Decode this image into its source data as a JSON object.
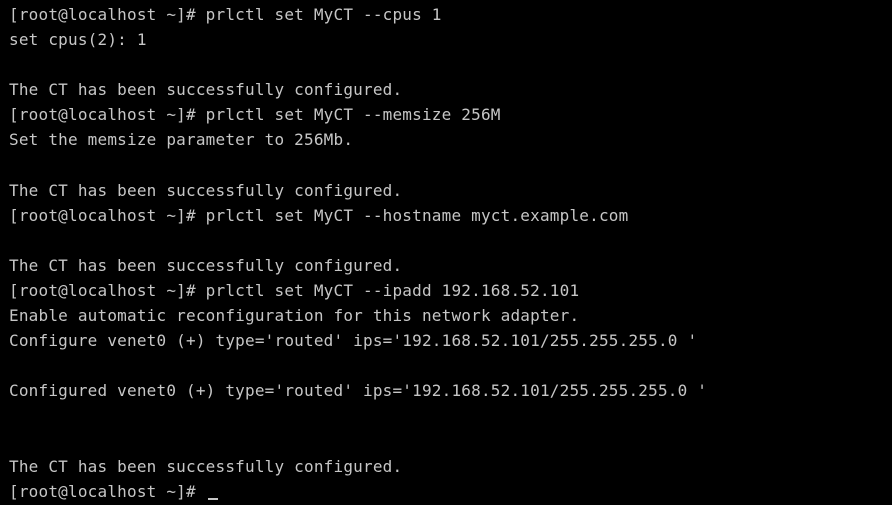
{
  "terminal": {
    "foreground": "#c6c6c6",
    "background": "#000000",
    "lines": [
      "[root@localhost ~]# prlctl set MyCT --cpus 1",
      "set cpus(2): 1",
      "",
      "The CT has been successfully configured.",
      "[root@localhost ~]# prlctl set MyCT --memsize 256M",
      "Set the memsize parameter to 256Mb.",
      "",
      "The CT has been successfully configured.",
      "[root@localhost ~]# prlctl set MyCT --hostname myct.example.com",
      "",
      "The CT has been successfully configured.",
      "[root@localhost ~]# prlctl set MyCT --ipadd 192.168.52.101",
      "Enable automatic reconfiguration for this network adapter.",
      "Configure venet0 (+) type='routed' ips='192.168.52.101/255.255.255.0 '",
      "",
      "Configured venet0 (+) type='routed' ips='192.168.52.101/255.255.255.0 '",
      "",
      "",
      "The CT has been successfully configured."
    ],
    "prompt": "[root@localhost ~]# "
  }
}
